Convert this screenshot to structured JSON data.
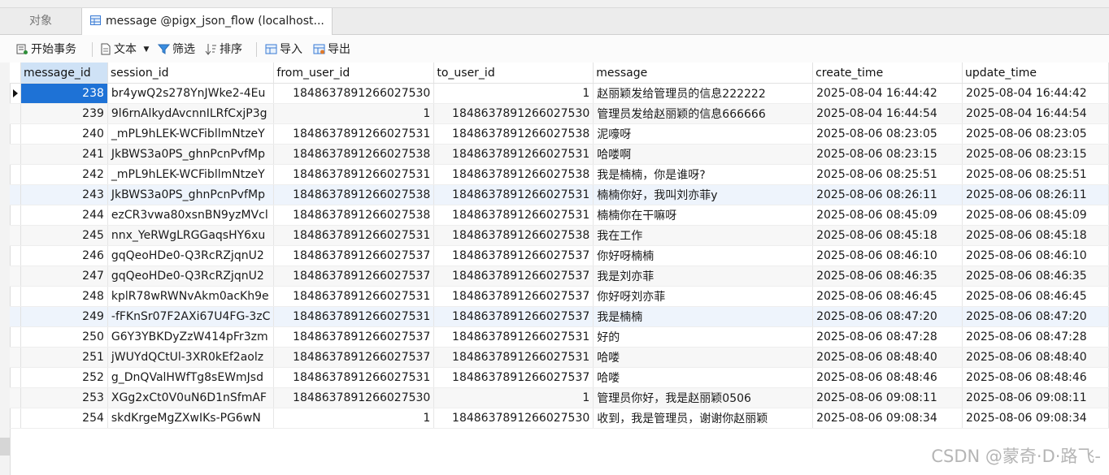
{
  "tabs": {
    "objects_label": "对象",
    "active_label": "message @pigx_json_flow (localhost..."
  },
  "toolbar": {
    "begin_transaction": "开始事务",
    "text": "文本",
    "filter": "筛选",
    "sort": "排序",
    "import": "导入",
    "export": "导出"
  },
  "table": {
    "columns": [
      "message_id",
      "session_id",
      "from_user_id",
      "to_user_id",
      "message",
      "create_time",
      "update_time"
    ],
    "rows": [
      [
        "238",
        "br4ywQ2s278YnJWke2-4Eu",
        "1848637891266027530",
        "1",
        "赵丽颖发给管理员的信息222222",
        "2025-08-04 16:44:42",
        "2025-08-04 16:44:42"
      ],
      [
        "239",
        "9l6rnAlkydAvcnnILRfCxjP3g",
        "1",
        "1848637891266027530",
        "管理员发给赵丽颖的信息666666",
        "2025-08-04 16:44:54",
        "2025-08-04 16:44:54"
      ],
      [
        "240",
        "_mPL9hLEK-WCFibllmNtzeY",
        "1848637891266027531",
        "1848637891266027538",
        "泥嚎呀",
        "2025-08-06 08:23:05",
        "2025-08-06 08:23:05"
      ],
      [
        "241",
        "JkBWS3a0PS_ghnPcnPvfMp",
        "1848637891266027538",
        "1848637891266027531",
        "哈喽啊",
        "2025-08-06 08:23:15",
        "2025-08-06 08:23:15"
      ],
      [
        "242",
        "_mPL9hLEK-WCFibllmNtzeY",
        "1848637891266027531",
        "1848637891266027538",
        "我是楠楠，你是谁呀?",
        "2025-08-06 08:25:51",
        "2025-08-06 08:25:51"
      ],
      [
        "243",
        "JkBWS3a0PS_ghnPcnPvfMp",
        "1848637891266027538",
        "1848637891266027531",
        "楠楠你好，我叫刘亦菲y",
        "2025-08-06 08:26:11",
        "2025-08-06 08:26:11"
      ],
      [
        "244",
        "ezCR3vwa80xsnBN9yzMVcl",
        "1848637891266027538",
        "1848637891266027531",
        "楠楠你在干嘛呀",
        "2025-08-06 08:45:09",
        "2025-08-06 08:45:09"
      ],
      [
        "245",
        "nnx_YeRWgLRGGaqsHY6xu",
        "1848637891266027531",
        "1848637891266027538",
        "我在工作",
        "2025-08-06 08:45:18",
        "2025-08-06 08:45:18"
      ],
      [
        "246",
        "gqQeoHDe0-Q3RcRZjqnU2",
        "1848637891266027537",
        "1848637891266027537",
        "你好呀楠楠",
        "2025-08-06 08:46:10",
        "2025-08-06 08:46:10"
      ],
      [
        "247",
        "gqQeoHDe0-Q3RcRZjqnU2",
        "1848637891266027537",
        "1848637891266027537",
        "我是刘亦菲",
        "2025-08-06 08:46:35",
        "2025-08-06 08:46:35"
      ],
      [
        "248",
        "kplR78wRWNvAkm0acKh9e",
        "1848637891266027531",
        "1848637891266027537",
        "你好呀刘亦菲",
        "2025-08-06 08:46:45",
        "2025-08-06 08:46:45"
      ],
      [
        "249",
        "-fFKnSr07F2AXi67U4FG-3zC",
        "1848637891266027531",
        "1848637891266027537",
        "我是楠楠",
        "2025-08-06 08:47:20",
        "2025-08-06 08:47:20"
      ],
      [
        "250",
        "G6Y3YBKDyZzW414pFr3zm",
        "1848637891266027537",
        "1848637891266027531",
        "好的",
        "2025-08-06 08:47:28",
        "2025-08-06 08:47:28"
      ],
      [
        "251",
        "jWUYdQCtUl-3XR0kEf2aolz",
        "1848637891266027537",
        "1848637891266027531",
        "哈喽",
        "2025-08-06 08:48:40",
        "2025-08-06 08:48:40"
      ],
      [
        "252",
        "g_DnQValHWfTg8sEWmJsd",
        "1848637891266027531",
        "1848637891266027537",
        "哈喽",
        "2025-08-06 08:48:46",
        "2025-08-06 08:48:46"
      ],
      [
        "253",
        "XGg2xCt0V0uN6D1nSfmAF",
        "1848637891266027530",
        "1",
        "管理员你好，我是赵丽颖0506",
        "2025-08-06 09:08:11",
        "2025-08-06 09:08:11"
      ],
      [
        "254",
        "skdKrgeMgZXwIKs-PG6wN",
        "1",
        "1848637891266027530",
        "收到，我是管理员，谢谢你赵丽颖",
        "2025-08-06 09:08:34",
        "2025-08-06 09:08:34"
      ]
    ]
  },
  "watermark": "CSDN @蒙奇·D·路飞-",
  "colors": {
    "selection": "#1e72d6",
    "header_selected": "#cfe2f6",
    "row_highlight": "#eef4fc"
  }
}
